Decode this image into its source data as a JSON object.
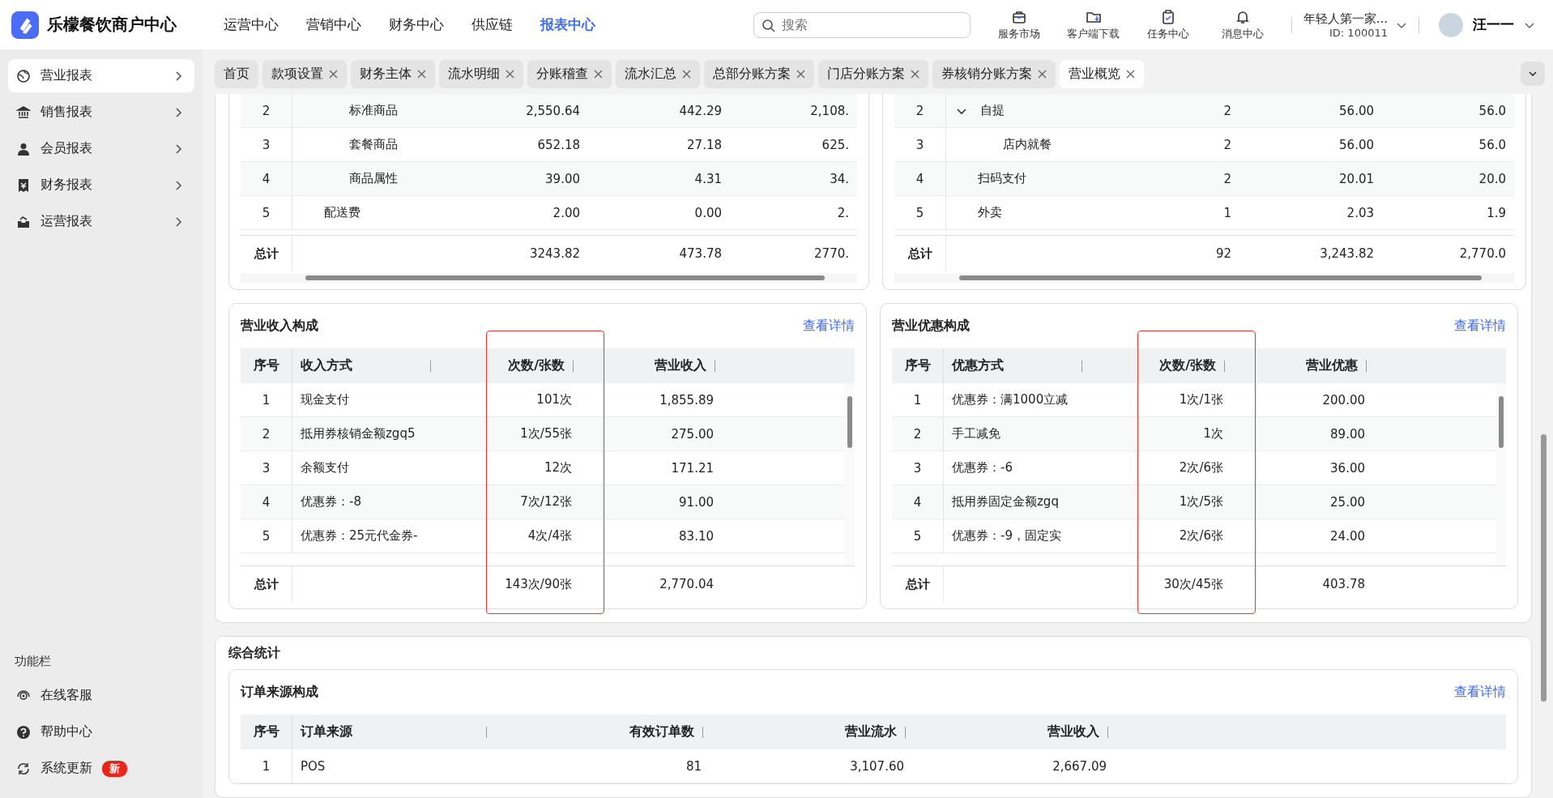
{
  "header": {
    "brand": "乐檬餐饮商户中心",
    "nav": [
      {
        "label": "运营中心",
        "selected": false
      },
      {
        "label": "营销中心",
        "selected": false
      },
      {
        "label": "财务中心",
        "selected": false
      },
      {
        "label": "供应链",
        "selected": false
      },
      {
        "label": "报表中心",
        "selected": true
      }
    ],
    "search": {
      "placeholder": "搜索"
    },
    "tools": [
      {
        "label": "服务市场"
      },
      {
        "label": "客户端下载"
      },
      {
        "label": "任务中心"
      },
      {
        "label": "消息中心"
      }
    ],
    "account": {
      "name": "年轻人第一家...",
      "id": "ID: 100011"
    },
    "user": {
      "name": "汪一一"
    }
  },
  "sidebar": {
    "items": [
      {
        "label": "营业报表",
        "selected": true
      },
      {
        "label": "销售报表",
        "selected": false
      },
      {
        "label": "会员报表",
        "selected": false
      },
      {
        "label": "财务报表",
        "selected": false
      },
      {
        "label": "运营报表",
        "selected": false
      }
    ],
    "footer_title": "功能栏",
    "footer_items": [
      {
        "label": "在线客服"
      },
      {
        "label": "帮助中心"
      },
      {
        "label": "系统更新",
        "badge": "新"
      }
    ]
  },
  "tabs": [
    {
      "label": "首页",
      "closable": false,
      "selected": false
    },
    {
      "label": "款项设置",
      "closable": true,
      "selected": false
    },
    {
      "label": "财务主体",
      "closable": true,
      "selected": false
    },
    {
      "label": "流水明细",
      "closable": true,
      "selected": false
    },
    {
      "label": "分账稽查",
      "closable": true,
      "selected": false
    },
    {
      "label": "流水汇总",
      "closable": true,
      "selected": false
    },
    {
      "label": "总部分账方案",
      "closable": true,
      "selected": false
    },
    {
      "label": "门店分账方案",
      "closable": true,
      "selected": false
    },
    {
      "label": "券核销分账方案",
      "closable": true,
      "selected": false
    },
    {
      "label": "营业概览",
      "closable": true,
      "selected": true
    }
  ],
  "top_tables": [
    {
      "rows": [
        {
          "children": [
            {
              "cells": [
                "2",
                "标准商品",
                "2,550.64",
                "442.29",
                "2,108."
              ]
            },
            {
              "cells": [
                "3",
                "套餐商品",
                "652.18",
                "27.18",
                "625."
              ]
            },
            {
              "cells": [
                "4",
                "商品属性",
                "39.00",
                "4.31",
                "34."
              ]
            }
          ]
        },
        {
          "cells": [
            "5",
            "配送费",
            "2.00",
            "0.00",
            "2."
          ]
        }
      ],
      "total": {
        "label": "总计",
        "values": [
          "3243.82",
          "473.78",
          "2770."
        ]
      }
    },
    {
      "rows": [
        {
          "cells": [
            "2",
            "自提",
            "2",
            "56.00",
            "56.0"
          ],
          "expanded": true,
          "children": [
            {
              "cells": [
                "3",
                "店内就餐",
                "2",
                "56.00",
                "56.0"
              ]
            }
          ]
        },
        {
          "cells": [
            "4",
            "扫码支付",
            "2",
            "20.01",
            "20.0"
          ]
        },
        {
          "cells": [
            "5",
            "外卖",
            "1",
            "2.03",
            "1.9"
          ]
        }
      ],
      "total": {
        "label": "总计",
        "values": [
          "92",
          "3,243.82",
          "2,770.0"
        ]
      }
    }
  ],
  "mid_panels": [
    {
      "title": "营业收入构成",
      "link": "查看详情",
      "columns": [
        {
          "label": "序号",
          "highlighted": false
        },
        {
          "label": "收入方式",
          "highlighted": false
        },
        {
          "label": "次数/张数",
          "highlighted": true
        },
        {
          "label": "营业收入",
          "highlighted": false
        }
      ],
      "rows": [
        [
          "1",
          "现金支付",
          "101次",
          "1,855.89"
        ],
        [
          "2",
          "抵用券核销金额zgq5",
          "1次/55张",
          "275.00"
        ],
        [
          "3",
          "余额支付",
          "12次",
          "171.21"
        ],
        [
          "4",
          "优惠券：-8",
          "7次/12张",
          "91.00"
        ],
        [
          "5",
          "优惠券：25元代金券-",
          "4次/4张",
          "83.10"
        ]
      ],
      "total": {
        "label": "总计",
        "values": [
          "143次/90张",
          "2,770.04"
        ]
      }
    },
    {
      "title": "营业优惠构成",
      "link": "查看详情",
      "columns": [
        {
          "label": "序号",
          "highlighted": false
        },
        {
          "label": "优惠方式",
          "highlighted": false
        },
        {
          "label": "次数/张数",
          "highlighted": true
        },
        {
          "label": "营业优惠",
          "highlighted": false
        }
      ],
      "rows": [
        [
          "1",
          "优惠券：满1000立减",
          "1次/1张",
          "200.00"
        ],
        [
          "2",
          "手工减免",
          "1次",
          "89.00"
        ],
        [
          "3",
          "优惠券：-6",
          "2次/6张",
          "36.00"
        ],
        [
          "4",
          "抵用券固定金额zgq",
          "1次/5张",
          "25.00"
        ],
        [
          "5",
          "优惠券：-9，固定实",
          "2次/6张",
          "24.00"
        ]
      ],
      "total": {
        "label": "总计",
        "values": [
          "30次/45张",
          "403.78"
        ]
      }
    }
  ],
  "summary": {
    "title": "综合统计",
    "panel": {
      "title": "订单来源构成",
      "link": "查看详情",
      "columns": [
        "序号",
        "订单来源",
        "有效订单数",
        "营业流水",
        "营业收入"
      ],
      "rows": [
        [
          "1",
          "POS",
          "81",
          "3,107.60",
          "2,667.09"
        ]
      ]
    }
  }
}
